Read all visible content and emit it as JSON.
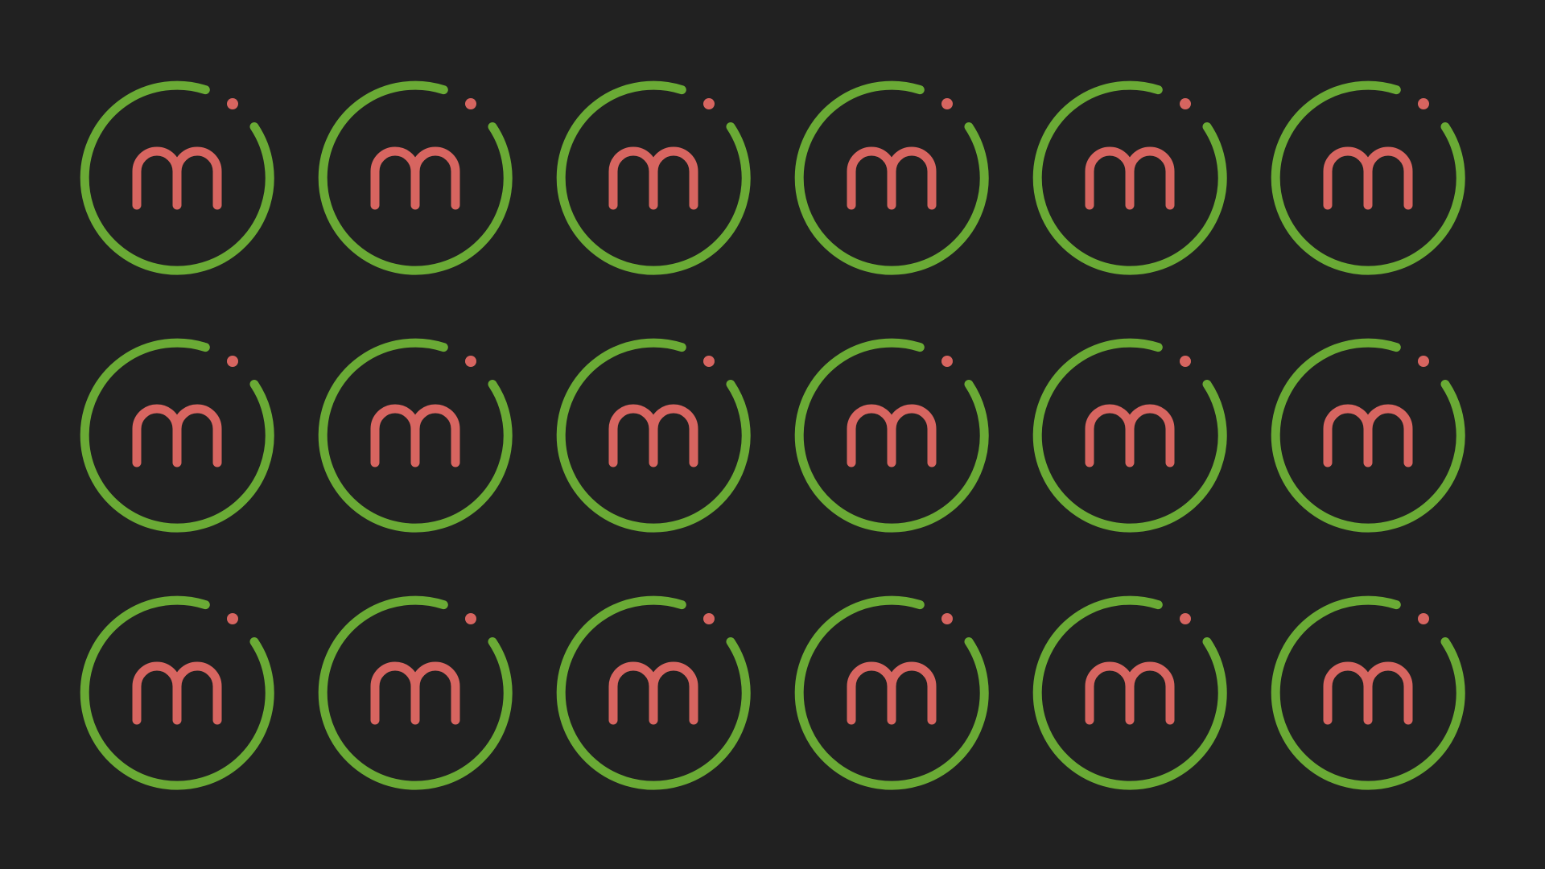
{
  "background_color": "#212121",
  "logo": {
    "letter": "m",
    "ring_color": "#6aaa35",
    "mark_color": "#d76560",
    "icon_name": "m-logo-icon"
  },
  "grid": {
    "rows": 3,
    "columns": 6
  }
}
